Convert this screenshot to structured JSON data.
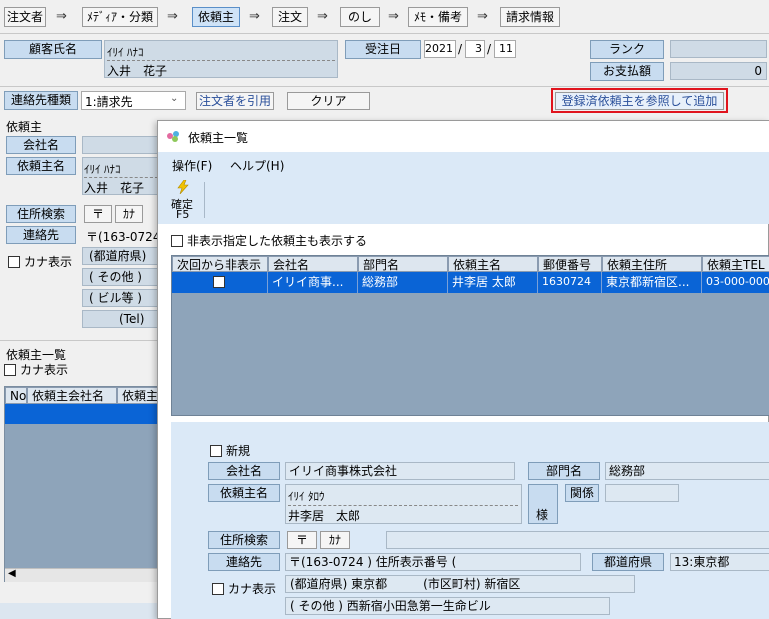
{
  "steps": [
    "注文者",
    "ﾒﾃﾞｨｱ・分類",
    "依頼主",
    "注文",
    "のし",
    "ﾒﾓ・備考",
    "請求情報"
  ],
  "arrow": "⇒",
  "customer": {
    "label": "顧客氏名",
    "kana": "ｲﾘｲ ﾊﾅｺ",
    "name": "入井　花子"
  },
  "order_date": {
    "label": "受注日",
    "year": "2021",
    "month": "3",
    "day": "11",
    "sep": "/"
  },
  "rank": {
    "label": "ランク",
    "value": ""
  },
  "payment": {
    "label": "お支払額",
    "value": "0"
  },
  "contact_type": {
    "label": "連絡先種類",
    "value": "1:請求先"
  },
  "cite_orderer_label": "注文者を引用",
  "clear_label": "クリア",
  "add_registered_label": "登録済依頼主を参照して追加",
  "left_form": {
    "section_label": "依頼主",
    "company_label": "会社名",
    "requester_label": "依頼主名",
    "requester_kana": "ｲﾘｲ ﾊﾅｺ",
    "requester_name": "入井　花子",
    "address_search_label": "住所検索",
    "btn_te": "〒",
    "btn_ka": "ｶﾅ",
    "contact_label": "連絡先",
    "postal": "〒(163-0724",
    "kana_display": "カナ表示",
    "prefecture": "(都道府県)",
    "other": "( その他 )",
    "building": "( ビル等 )",
    "tel": "(Tel)"
  },
  "left_list": {
    "title": "依頼主一覧",
    "kana_display": "カナ表示",
    "columns": [
      "No",
      "依頼主会社名",
      "依頼主"
    ]
  },
  "dialog": {
    "title": "依頼主一覧",
    "menu": [
      "操作(F)",
      "ヘルプ(H)"
    ],
    "confirm_label": "確定",
    "confirm_key": "F5",
    "show_hidden_label": "非表示指定した依頼主も表示する",
    "columns": [
      "次回から非表示",
      "会社名",
      "部門名",
      "依頼主名",
      "郵便番号",
      "依頼主住所",
      "依頼主TEL"
    ],
    "rows": [
      {
        "company": "イリイ商事...",
        "dept": "総務部",
        "name": "井李居 太郎",
        "postal": "1630724",
        "address": "東京都新宿区...",
        "tel": "03-000-0000"
      }
    ],
    "detail": {
      "new_label": "新規",
      "company_label": "会社名",
      "company_value": "イリイ商事株式会社",
      "dept_label": "部門名",
      "dept_value": "総務部",
      "requester_label": "依頼主名",
      "requester_kana": "ｲﾘｲ ﾀﾛｳ",
      "requester_name": "井李居　太郎",
      "honorific": "様",
      "relation_label": "関係",
      "address_search_label": "住所検索",
      "btn_te": "〒",
      "btn_ka": "ｶﾅ",
      "contact_label": "連絡先",
      "postal_line": "〒(163-0724 ) 住所表示番号 (　　　　　　　　　　　)",
      "prefecture_label": "都道府県",
      "prefecture_value": "13:東京都",
      "kana_display": "カナ表示",
      "address_line": "(都道府県) 東京都　　　(市区町村) 新宿区",
      "other_line": "( その他 ) 西新宿小田急第一生命ビル"
    }
  },
  "colors": {
    "selection": "#0a64d6",
    "grid_bg": "#8ea4ba",
    "highlight_border": "#e0141e"
  }
}
